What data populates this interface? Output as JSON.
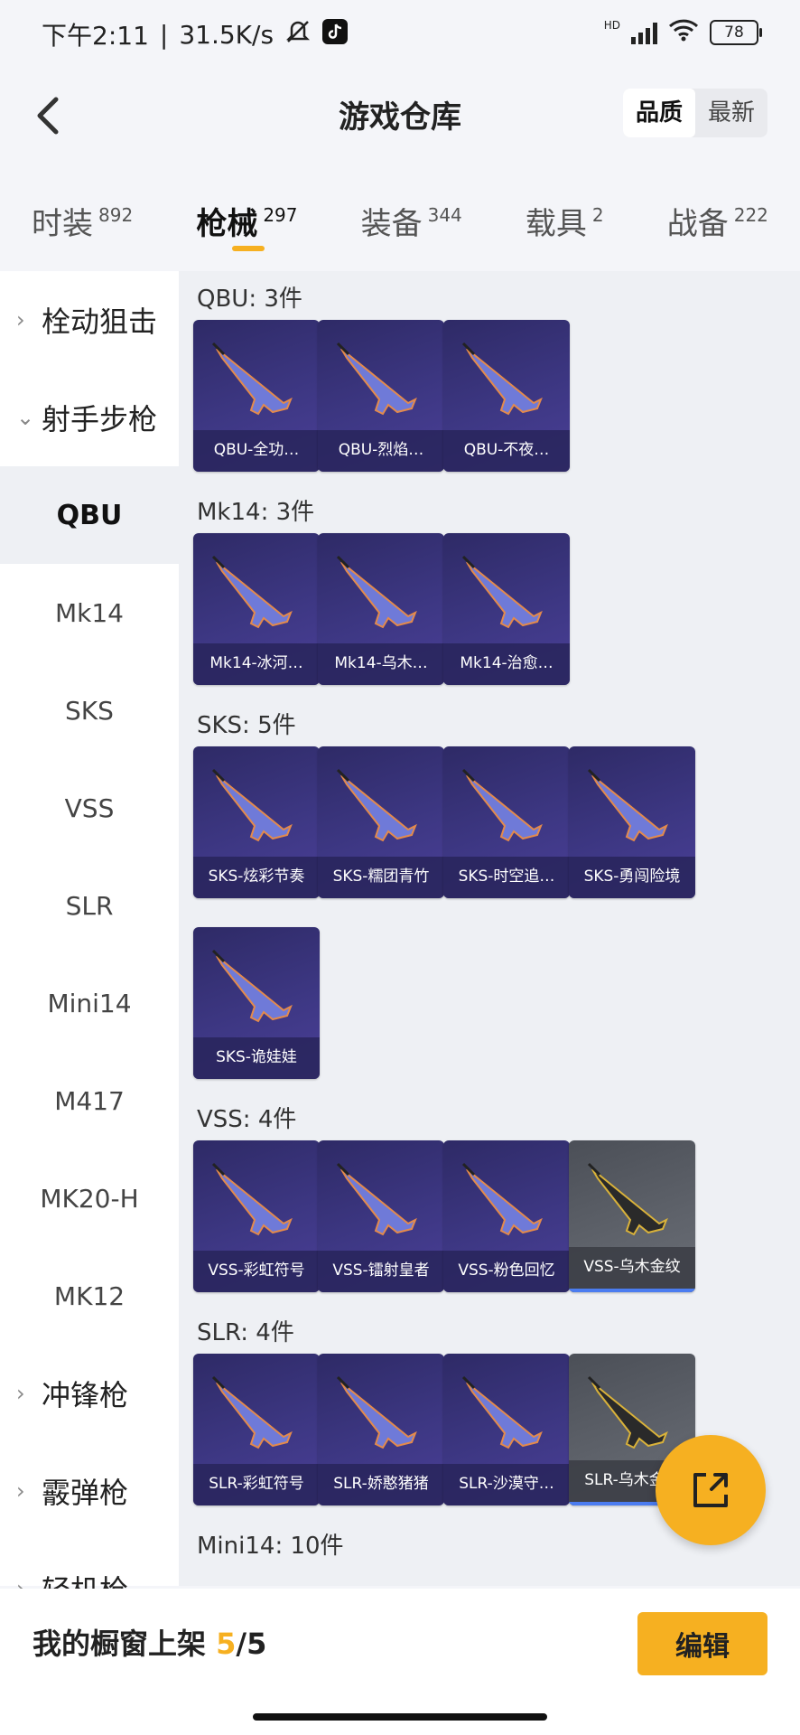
{
  "status": {
    "time": "下午2:11",
    "speed": "31.5K/s",
    "battery": "78",
    "hd": "HD"
  },
  "header": {
    "title": "游戏仓库",
    "sort_options": [
      "品质",
      "最新"
    ],
    "sort_active": 0
  },
  "tabs": [
    {
      "label": "时装",
      "count": "892"
    },
    {
      "label": "枪械",
      "count": "297",
      "active": true
    },
    {
      "label": "装备",
      "count": "344"
    },
    {
      "label": "载具",
      "count": "2"
    },
    {
      "label": "战备",
      "count": "222"
    }
  ],
  "sidebar": [
    {
      "label": "栓动狙击",
      "group": true,
      "expanded": false
    },
    {
      "label": "射手步枪",
      "group": true,
      "expanded": true
    },
    {
      "label": "QBU",
      "selected": true
    },
    {
      "label": "Mk14"
    },
    {
      "label": "SKS"
    },
    {
      "label": "VSS"
    },
    {
      "label": "SLR"
    },
    {
      "label": "Mini14"
    },
    {
      "label": "M417"
    },
    {
      "label": "MK20-H"
    },
    {
      "label": "MK12"
    },
    {
      "label": "冲锋枪",
      "group": true,
      "expanded": false
    },
    {
      "label": "霰弹枪",
      "group": true,
      "expanded": false
    },
    {
      "label": "轻机枪",
      "group": true,
      "expanded": false
    }
  ],
  "sections": [
    {
      "title": "QBU: 3件",
      "items": [
        "QBU-全功…",
        "QBU-烈焰…",
        "QBU-不夜…"
      ]
    },
    {
      "title": "Mk14: 3件",
      "items": [
        "Mk14-冰河…",
        "Mk14-乌木…",
        "Mk14-治愈…"
      ]
    },
    {
      "title": "SKS: 5件",
      "items": [
        "SKS-炫彩节奏",
        "SKS-糯团青竹",
        "SKS-时空追…",
        "SKS-勇闯险境",
        "SKS-诡娃娃"
      ]
    },
    {
      "title": "VSS: 4件",
      "items": [
        "VSS-彩虹符号",
        "VSS-镭射皇者",
        "VSS-粉色回忆",
        "VSS-乌木金纹"
      ]
    },
    {
      "title": "SLR: 4件",
      "items": [
        "SLR-彩虹符号",
        "SLR-娇憨猪猪",
        "SLR-沙漠守…",
        "SLR-乌木金纹"
      ]
    },
    {
      "title": "Mini14: 10件",
      "items": []
    }
  ],
  "bottom": {
    "label": "我的橱窗上架",
    "current": "5",
    "total": "/5",
    "edit_label": "编辑"
  },
  "colors": {
    "accent": "#f6b021",
    "card_purple": "#3d3783",
    "card_grey": "#5f636b"
  }
}
